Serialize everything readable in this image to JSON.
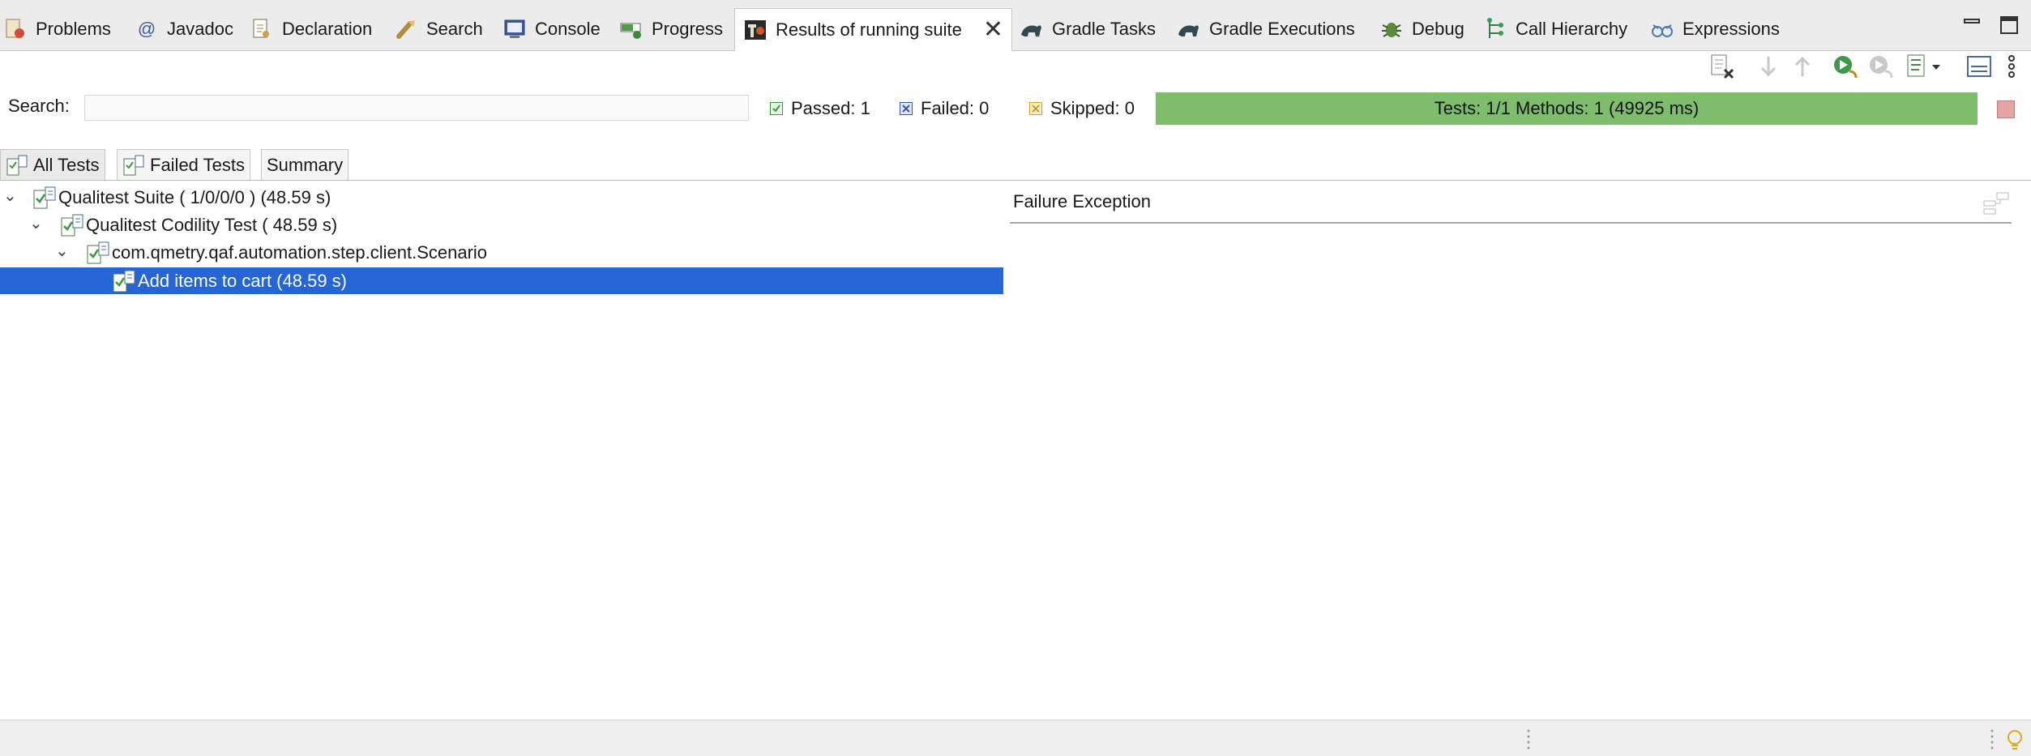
{
  "tabs": [
    {
      "label": "Problems",
      "icon": "problems-icon"
    },
    {
      "label": "Javadoc",
      "icon": "javadoc-icon"
    },
    {
      "label": "Declaration",
      "icon": "declaration-icon"
    },
    {
      "label": "Search",
      "icon": "search-icon"
    },
    {
      "label": "Console",
      "icon": "console-icon"
    },
    {
      "label": "Progress",
      "icon": "progress-icon"
    },
    {
      "label": "Results of running suite",
      "icon": "testng-icon",
      "active": true
    },
    {
      "label": "Gradle Tasks",
      "icon": "gradle-icon"
    },
    {
      "label": "Gradle Executions",
      "icon": "gradle-icon"
    },
    {
      "label": "Debug",
      "icon": "debug-icon"
    },
    {
      "label": "Call Hierarchy",
      "icon": "call-hierarchy-icon"
    },
    {
      "label": "Expressions",
      "icon": "expressions-icon"
    }
  ],
  "javadoc_glyph": "@",
  "close_glyph": "✕",
  "search": {
    "label": "Search:",
    "value": "",
    "placeholder": ""
  },
  "stats": {
    "passed": "Passed: 1",
    "failed": "Failed: 0",
    "skipped": "Skipped: 0"
  },
  "progress": {
    "text": "Tests: 1/1  Methods: 1 (49925 ms)",
    "fraction": 1.0,
    "color": "#7dbd6c"
  },
  "subtabs": [
    {
      "label": "All Tests",
      "active": true
    },
    {
      "label": "Failed Tests"
    },
    {
      "label": "Summary"
    }
  ],
  "tree": [
    {
      "label": "Qualitest Suite ( 1/0/0/0 ) (48.59 s)",
      "expanded": true
    },
    {
      "label": "Qualitest Codility Test ( 48.59 s)",
      "expanded": true
    },
    {
      "label": "com.qmetry.qaf.automation.step.client.Scenario",
      "expanded": true
    },
    {
      "label": "Add items to cart  (48.59 s)",
      "selected": true
    }
  ],
  "chevron_glyph": "⌄",
  "failure_panel": {
    "title": "Failure Exception"
  },
  "colors": {
    "selection": "#2665d6",
    "passed": "#3a9a3a",
    "failed": "#3458a8",
    "skipped": "#d9a520"
  }
}
